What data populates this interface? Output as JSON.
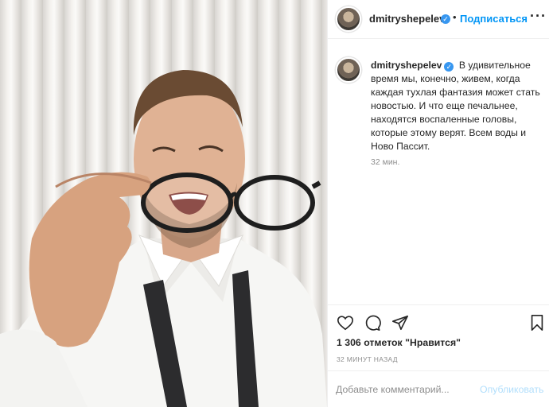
{
  "post": {
    "username": "dmitryshepelev",
    "verified_icon": "verified-badge-icon",
    "follow_label": "Подписаться",
    "more_icon": "more-options-icon",
    "caption": "В удивительное время мы, конечно, живем, когда каждая тухлая фантазия может стать новостью. И что еще печальнее, находятся воспаленные головы, которые этому верят. Всем воды и Ново Пассит.",
    "caption_time": "32 мин.",
    "likes": "1 306 отметок \"Нравится\"",
    "post_time": "32 МИНУТ НАЗАД",
    "comment_placeholder": "Добавьте комментарий...",
    "publish_label": "Опубликовать"
  },
  "icons": {
    "like": "heart-icon",
    "comment": "comment-bubble-icon",
    "share": "paper-plane-icon",
    "save": "bookmark-icon"
  },
  "colors": {
    "accent": "#0095f6",
    "verified": "#3897f0",
    "text": "#262626",
    "muted": "#8e8e8e",
    "publish_disabled": "#b2dffc",
    "border": "#efefef"
  }
}
